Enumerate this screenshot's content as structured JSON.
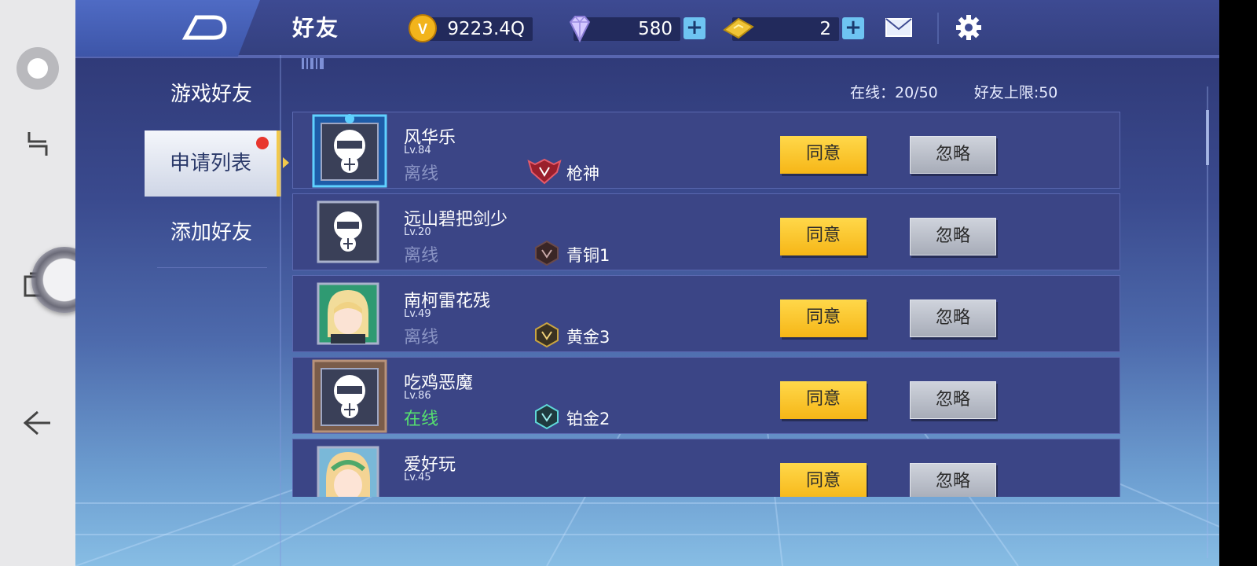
{
  "header": {
    "title": "好友",
    "gold": "9223.4Q",
    "diamonds": "580",
    "coupons": "2",
    "currency_icons": [
      "gold-coin-icon",
      "diamond-icon",
      "coupon-icon"
    ]
  },
  "menu": {
    "items": [
      {
        "label": "游戏好友",
        "active": false
      },
      {
        "label": "申请列表",
        "active": true,
        "badge": true
      },
      {
        "label": "添加好友",
        "active": false
      }
    ]
  },
  "stats": {
    "online": "在线：20/50",
    "limit": "好友上限:50"
  },
  "requests": [
    {
      "name": "风华乐",
      "level": "Lv.84",
      "status": "离线",
      "rank": "枪神",
      "agree": "同意",
      "ignore": "忽略"
    },
    {
      "name": "远山碧把剑少",
      "level": "Lv.20",
      "status": "离线",
      "rank": "青铜1",
      "agree": "同意",
      "ignore": "忽略"
    },
    {
      "name": "南柯雷花残",
      "level": "Lv.49",
      "status": "离线",
      "rank": "黄金3",
      "agree": "同意",
      "ignore": "忽略"
    },
    {
      "name": "吃鸡恶魔",
      "level": "Lv.86",
      "status": "在线",
      "rank": "铂金2",
      "agree": "同意",
      "ignore": "忽略"
    },
    {
      "name": "爱好玩",
      "level": "Lv.45",
      "status": "",
      "rank": "",
      "agree": "同意",
      "ignore": "忽略"
    }
  ],
  "colors": {
    "agree_button": "#f6c230",
    "ignore_button": "#b9bdc8",
    "online_status": "#56e26e",
    "active_tab_marker": "#f2c94c",
    "badge": "#e8362e"
  }
}
